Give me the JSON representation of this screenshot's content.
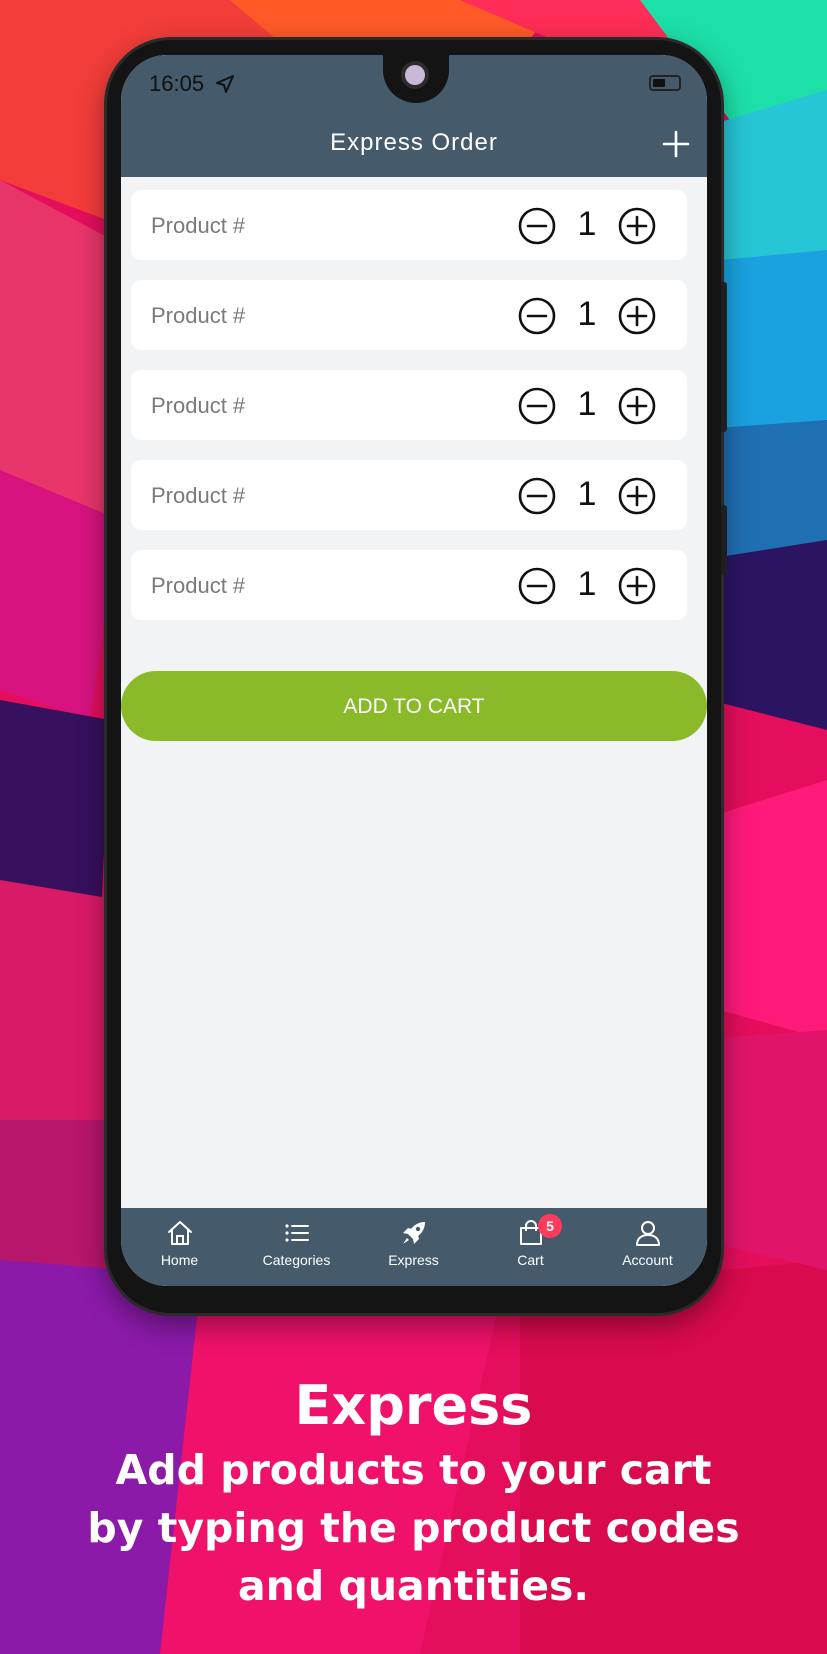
{
  "status_bar": {
    "time": "16:05"
  },
  "header": {
    "title": "Express Order",
    "add_icon": "plus-icon"
  },
  "rows": [
    {
      "placeholder": "Product #",
      "quantity": "1"
    },
    {
      "placeholder": "Product #",
      "quantity": "1"
    },
    {
      "placeholder": "Product #",
      "quantity": "1"
    },
    {
      "placeholder": "Product #",
      "quantity": "1"
    },
    {
      "placeholder": "Product #",
      "quantity": "1"
    }
  ],
  "add_to_cart_label": "ADD TO CART",
  "tabs": [
    {
      "label": "Home",
      "icon": "home-icon"
    },
    {
      "label": "Categories",
      "icon": "list-icon"
    },
    {
      "label": "Express",
      "icon": "rocket-icon"
    },
    {
      "label": "Cart",
      "icon": "shopping-bag-icon",
      "badge": "5"
    },
    {
      "label": "Account",
      "icon": "user-icon"
    }
  ],
  "caption": {
    "title": "Express",
    "lines": [
      "Add products to your cart",
      "by typing the product codes",
      "and quantities."
    ]
  },
  "colors": {
    "header": "#455a6b",
    "accent_button": "#8aba29",
    "badge": "#ff3b5c",
    "screen_bg": "#f2f3f5"
  }
}
